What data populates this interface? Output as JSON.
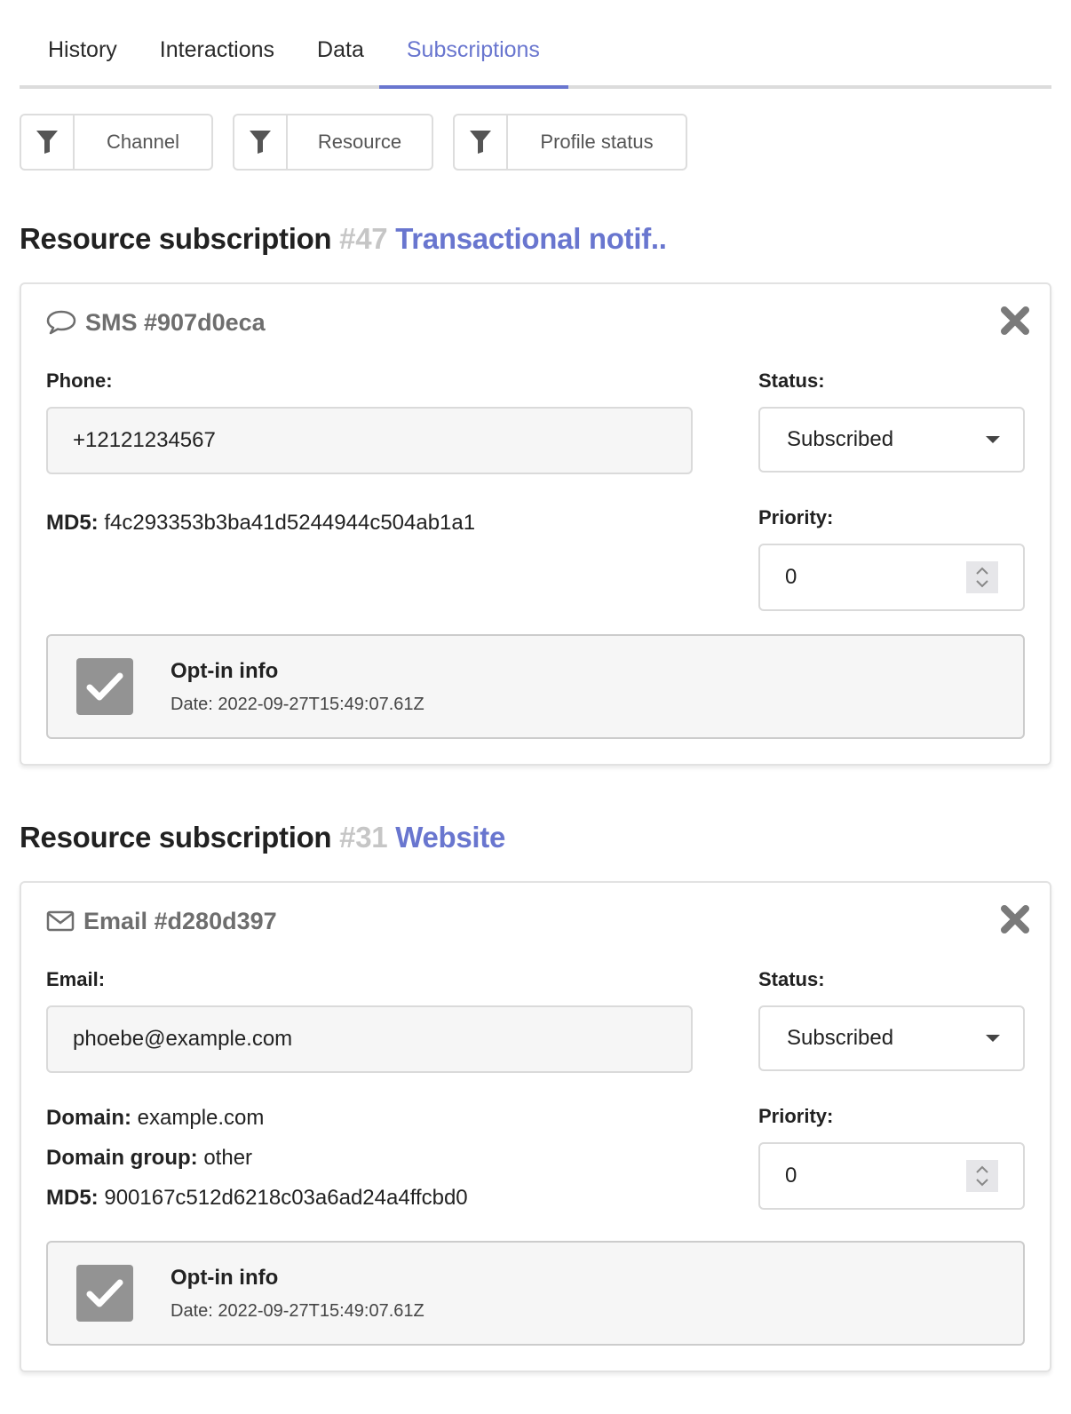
{
  "tabs": [
    {
      "label": "History",
      "active": false
    },
    {
      "label": "Interactions",
      "active": false
    },
    {
      "label": "Data",
      "active": false
    },
    {
      "label": "Subscriptions",
      "active": true
    }
  ],
  "filters": [
    {
      "label": "Channel",
      "icon": "filter-icon"
    },
    {
      "label": "Resource",
      "icon": "filter-icon"
    },
    {
      "label": "Profile status",
      "icon": "filter-icon"
    }
  ],
  "colors": {
    "accent": "#6976cf",
    "id_gray": "#c6c6c6",
    "checkbox": "#939393"
  },
  "subscriptions": [
    {
      "heading": "Resource subscription",
      "id": "#47",
      "name": "Transactional notif..",
      "card": {
        "icon": "chat-bubble-icon",
        "title": "SMS #907d0eca",
        "field_label": "Phone:",
        "field_value": "+12121234567",
        "status_label": "Status:",
        "status_value": "Subscribed",
        "priority_label": "Priority:",
        "priority_value": "0",
        "meta": [
          {
            "key": "MD5:",
            "value": "f4c293353b3ba41d5244944c504ab1a1"
          }
        ],
        "optin": {
          "title": "Opt-in info",
          "date": "Date: 2022-09-27T15:49:07.61Z",
          "checked": true
        }
      }
    },
    {
      "heading": "Resource subscription",
      "id": "#31",
      "name": "Website",
      "card": {
        "icon": "envelope-icon",
        "title": "Email #d280d397",
        "field_label": "Email:",
        "field_value": "phoebe@example.com",
        "status_label": "Status:",
        "status_value": "Subscribed",
        "priority_label": "Priority:",
        "priority_value": "0",
        "meta": [
          {
            "key": "Domain:",
            "value": "example.com"
          },
          {
            "key": "Domain group:",
            "value": "other"
          },
          {
            "key": "MD5:",
            "value": "900167c512d6218c03a6ad24a4ffcbd0"
          }
        ],
        "optin": {
          "title": "Opt-in info",
          "date": "Date: 2022-09-27T15:49:07.61Z",
          "checked": true
        }
      }
    }
  ]
}
